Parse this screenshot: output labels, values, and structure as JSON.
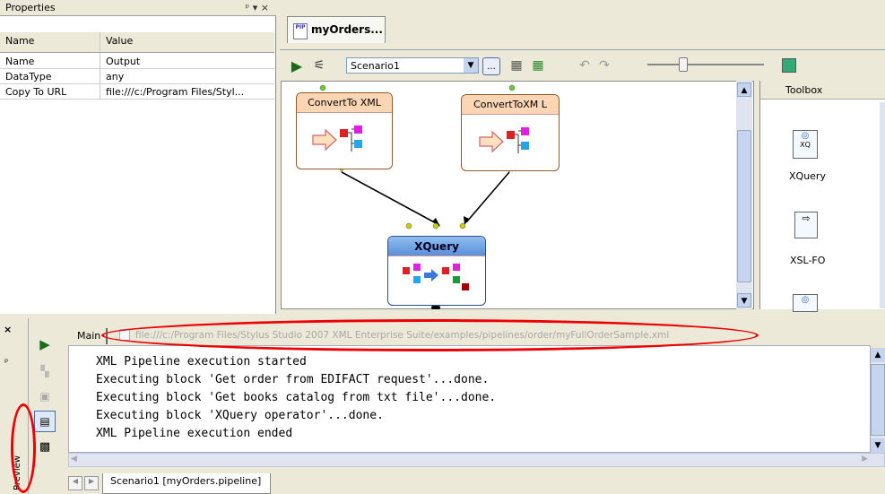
{
  "properties_panel": {
    "title": "Properties",
    "pin": "ᵖ ▾ ×",
    "columns": [
      "Name",
      "Value"
    ],
    "rows": [
      {
        "name": "Name",
        "value": "Output"
      },
      {
        "name": "DataType",
        "value": "any"
      },
      {
        "name": "Copy To URL",
        "value": "file:///c:/Program Files/Styl..."
      }
    ]
  },
  "document_tab": {
    "label": "myOrders..."
  },
  "toolbar": {
    "scenario_select": "Scenario1",
    "ellipsis": "..."
  },
  "canvas": {
    "blocks": [
      {
        "title": "ConvertTo XML"
      },
      {
        "title": "ConvertToXM L"
      },
      {
        "title": "XQuery"
      }
    ]
  },
  "toolbox": {
    "title": "Toolbox",
    "items": [
      {
        "label": "XQuery",
        "icon_text": "XQ"
      },
      {
        "label": "XSL-FO"
      }
    ]
  },
  "output": {
    "tab_label": "Main",
    "url": "file:///c:/Program Files/Stylus Studio 2007 XML Enterprise Suite/examples/pipelines/order/myFullOrderSample.xml",
    "log_lines": [
      "XML Pipeline execution started",
      "Executing block 'Get order from EDIFACT request'...done.",
      "Executing block 'Get books catalog from txt file'...done.",
      "Executing block 'XQuery operator'...done.",
      "XML Pipeline execution ended"
    ],
    "side_label": "Preview",
    "bottom_tab": "Scenario1 [myOrders.pipeline]"
  },
  "colors": {
    "highlight": "#e00000",
    "block_header": "#fcd5b4",
    "xquery_header": "#5a8fd8"
  }
}
